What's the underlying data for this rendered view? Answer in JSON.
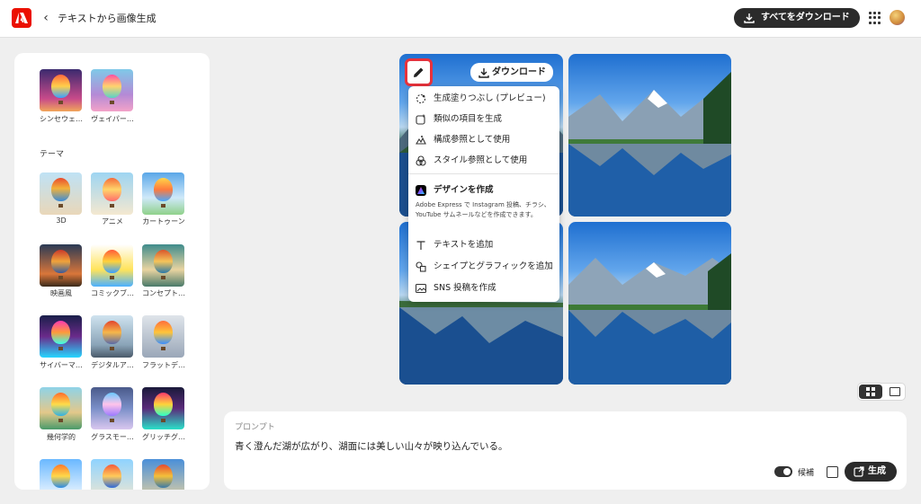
{
  "header": {
    "title": "テキストから画像生成",
    "download_all_label": "すべてをダウンロード"
  },
  "sidebar": {
    "top_items": [
      {
        "label": "シンセウェ…"
      },
      {
        "label": "ヴェイパー…"
      }
    ],
    "section_title": "テーマ",
    "theme_items": [
      {
        "label": "3D"
      },
      {
        "label": "アニメ"
      },
      {
        "label": "カートゥーン"
      },
      {
        "label": "映画風"
      },
      {
        "label": "コミックブ…"
      },
      {
        "label": "コンセプト…"
      },
      {
        "label": "サイバーマ…"
      },
      {
        "label": "デジタルア…"
      },
      {
        "label": "フラットデ…"
      },
      {
        "label": "幾何学的"
      },
      {
        "label": "グラスモー…"
      },
      {
        "label": "グリッチグ…"
      }
    ]
  },
  "image_card": {
    "download_label": "ダウンロード"
  },
  "context_menu": {
    "items": [
      {
        "label": "生成塗りつぶし (プレビュー)",
        "icon": "generative-fill-icon"
      },
      {
        "label": "類似の項目を生成",
        "icon": "generate-similar-icon"
      },
      {
        "label": "構成参照として使用",
        "icon": "composition-reference-icon"
      },
      {
        "label": "スタイル参照として使用",
        "icon": "style-reference-icon"
      }
    ],
    "express_title": "デザインを作成",
    "express_description": "Adobe Express で Instagram 投稿、チラシ、YouTube サムネールなどを作成できます。",
    "express_items": [
      {
        "label": "テキストを追加",
        "icon": "text-icon"
      },
      {
        "label": "シェイプとグラフィックを追加",
        "icon": "shapes-icon"
      },
      {
        "label": "SNS 投稿を作成",
        "icon": "image-icon"
      }
    ]
  },
  "prompt": {
    "label": "プロンプト",
    "text": "青く澄んだ湖が広がり、湖面には美しい山々が映り込んでいる。",
    "toggle_label": "候補",
    "generate_label": "生成"
  }
}
